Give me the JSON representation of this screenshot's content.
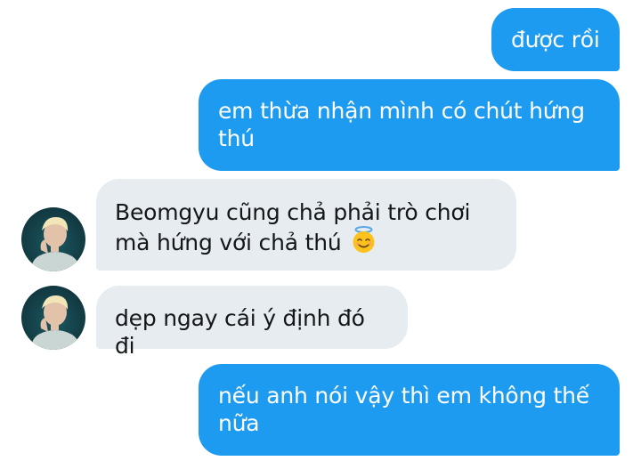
{
  "messages": [
    {
      "direction": "outgoing",
      "text": "được rồi"
    },
    {
      "direction": "outgoing",
      "text": "em thừa nhận mình có chút hứng thú"
    },
    {
      "direction": "incoming",
      "text": "Beomgyu cũng chả phải trò chơi mà hứng với chả thú",
      "emoji": "smiling-face-with-halo"
    },
    {
      "direction": "incoming",
      "text": "dẹp ngay cái ý định đó đi"
    },
    {
      "direction": "outgoing",
      "text": "nếu anh nói vậy thì em không thế nữa"
    }
  ],
  "colors": {
    "outgoing_bubble": "#1d9bf0",
    "incoming_bubble": "#e6ecf0"
  }
}
